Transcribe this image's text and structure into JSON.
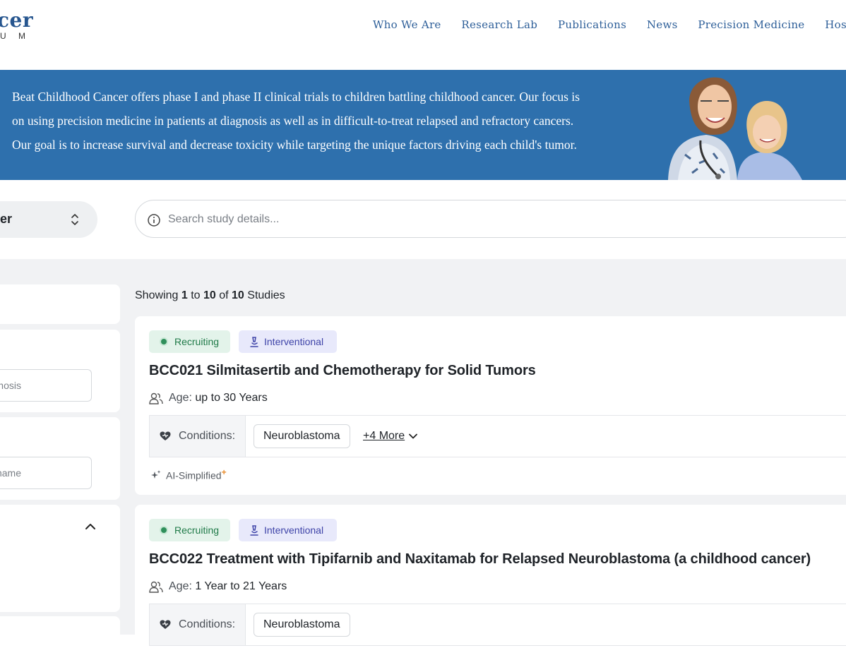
{
  "logo": {
    "main": "cer",
    "sub": "U M"
  },
  "nav": [
    "Who We Are",
    "Research Lab",
    "Publications",
    "News",
    "Precision Medicine",
    "Hospitals"
  ],
  "hero": {
    "lines": [
      "Beat Childhood Cancer offers phase I and phase II clinical trials to children battling childhood cancer. Our focus is",
      "on using precision medicine in patients at diagnosis as well as in difficult-to-treat relapsed and refractory cancers.",
      "Our goal is to increase survival and decrease toxicity while targeting the unique factors driving each child's tumor."
    ]
  },
  "filters": {
    "cancer_select_label": "er",
    "search_placeholder": "Search study details..."
  },
  "sidebar": {
    "diagnosis_placeholder": "iagnosis",
    "location_placeholder": "ovince name"
  },
  "results": {
    "prefix": "Showing",
    "from": "1",
    "to_word": "to",
    "to": "10",
    "of_word": "of",
    "total": "10",
    "suffix": "Studies"
  },
  "studies": [
    {
      "status": "Recruiting",
      "type": "Interventional",
      "title": "BCC021 Silmitasertib and Chemotherapy for Solid Tumors",
      "age_label": "Age:",
      "age": "up to 30 Years",
      "conditions_label": "Conditions:",
      "condition": "Neuroblastoma",
      "more": "+4 More",
      "ai_label": "AI-Simplified",
      "ai_mark": "+"
    },
    {
      "status": "Recruiting",
      "type": "Interventional",
      "title": "BCC022 Treatment with Tipifarnib and Naxitamab for Relapsed Neuroblastoma (a childhood cancer)",
      "age_label": "Age:",
      "age": "1 Year to 21 Years",
      "conditions_label": "Conditions:",
      "condition": "Neuroblastoma"
    }
  ],
  "colors": {
    "brand_blue": "#27568f",
    "hero_bg": "#2e70ad",
    "recruiting": "#1f7a48",
    "interventional": "#3e43a8"
  }
}
